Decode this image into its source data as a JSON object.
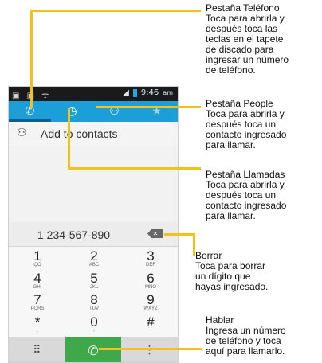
{
  "status_bar": {
    "time": "9:46",
    "ampm": "am"
  },
  "contacts_row": {
    "label": "Add to contacts"
  },
  "dialer": {
    "number": "1 234-567-890"
  },
  "keys": [
    {
      "digit": "1",
      "letters": "QO"
    },
    {
      "digit": "2",
      "letters": "ABC"
    },
    {
      "digit": "3",
      "letters": "DEF"
    },
    {
      "digit": "4",
      "letters": "GHI"
    },
    {
      "digit": "5",
      "letters": "JKL"
    },
    {
      "digit": "6",
      "letters": "MNO"
    },
    {
      "digit": "7",
      "letters": "PQRS"
    },
    {
      "digit": "8",
      "letters": "TUV"
    },
    {
      "digit": "9",
      "letters": "WXYZ"
    },
    {
      "digit": "*",
      "letters": ","
    },
    {
      "digit": "0",
      "letters": "+"
    },
    {
      "digit": "#",
      "letters": ""
    }
  ],
  "callouts": {
    "telefono": [
      "Pestaña Teléfono",
      "Toca para abrirla y",
      "después toca las",
      "teclas en el tapete",
      "de discado para",
      "ingresar un número",
      "de teléfono."
    ],
    "people": [
      "Pestaña People",
      "Toca para abrirla y",
      "después toca un",
      "contacto ingresado",
      "para llamar."
    ],
    "llamadas": [
      "Pestaña Llamadas",
      "Toca para abrirla y",
      "después toca un",
      "contacto ingresado",
      "para llamar."
    ],
    "borrar": [
      "Borrar",
      "Toca para borrar",
      "un dígito que",
      "hayas ingresado."
    ],
    "hablar": [
      "Hablar",
      "Ingresa un número",
      "de teléfono y toca",
      "aquí para llamarlo."
    ]
  },
  "colors": {
    "tab_bar": "#1c9ed8",
    "call_button": "#3fa84b",
    "callout_line": "#f2c21b"
  }
}
